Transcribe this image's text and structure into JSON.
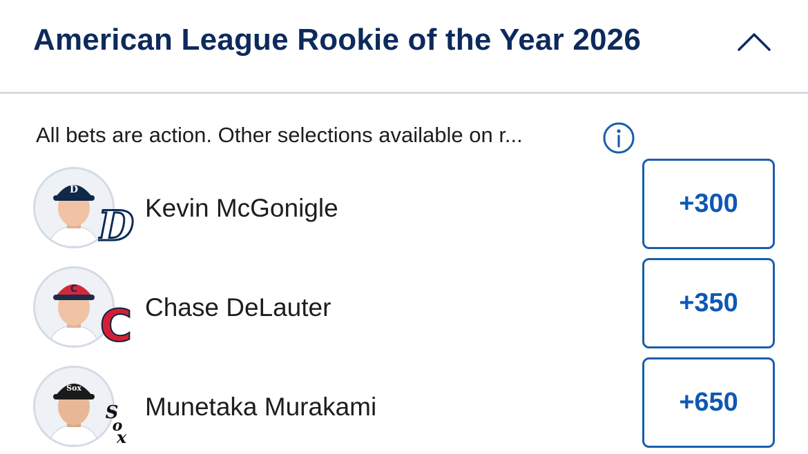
{
  "market": {
    "title": "American League Rookie of the Year 2026",
    "collapse_icon": "chevron-up-icon",
    "notice": "All bets are action. Other selections available on r...",
    "info_icon": "info-icon"
  },
  "runners": [
    {
      "name": "Kevin McGonigle",
      "odds": "+300",
      "team_logo": "detroit-tigers-logo",
      "cap_letter": "D",
      "cap_color": "#10284a",
      "logo_color": "#0c2c56"
    },
    {
      "name": "Chase DeLauter",
      "odds": "+350",
      "team_logo": "cleveland-guardians-logo",
      "cap_letter": "C",
      "cap_color": "#d3283c",
      "logo_color": "#d31f35"
    },
    {
      "name": "Munetaka Murakami",
      "odds": "+650",
      "team_logo": "chicago-white-sox-logo",
      "cap_letter": "Sox",
      "cap_color": "#1a1a1a",
      "logo_color": "#111111"
    }
  ],
  "colors": {
    "title": "#0d2a5c",
    "accent": "#1a5dae",
    "odds_text": "#0f58b4",
    "divider": "#d5dbe3"
  }
}
